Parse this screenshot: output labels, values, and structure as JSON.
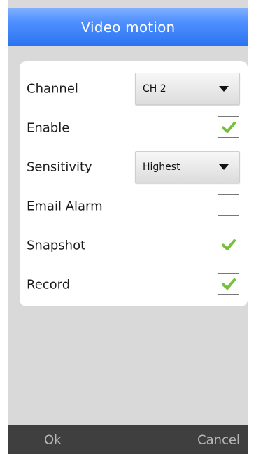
{
  "header": {
    "title": "Video motion"
  },
  "form": {
    "channel": {
      "label": "Channel",
      "value": "CH 2",
      "caret_icon": "triangle-down-icon"
    },
    "enable": {
      "label": "Enable",
      "checked": true,
      "check_icon": "checkmark-icon"
    },
    "sensitivity": {
      "label": "Sensitivity",
      "value": "Highest",
      "caret_icon": "triangle-down-icon"
    },
    "email_alarm": {
      "label": "Email Alarm",
      "checked": false
    },
    "snapshot": {
      "label": "Snapshot",
      "checked": true,
      "check_icon": "checkmark-icon"
    },
    "record": {
      "label": "Record",
      "checked": true,
      "check_icon": "checkmark-icon"
    }
  },
  "footer": {
    "ok_label": "Ok",
    "cancel_label": "Cancel"
  },
  "colors": {
    "header_blue": "#2c73f0",
    "check_green": "#77c13a",
    "dialog_gray": "#d9d9d9",
    "bottom_bar": "#3f3f3f",
    "bottom_text": "#b7b7b7"
  }
}
